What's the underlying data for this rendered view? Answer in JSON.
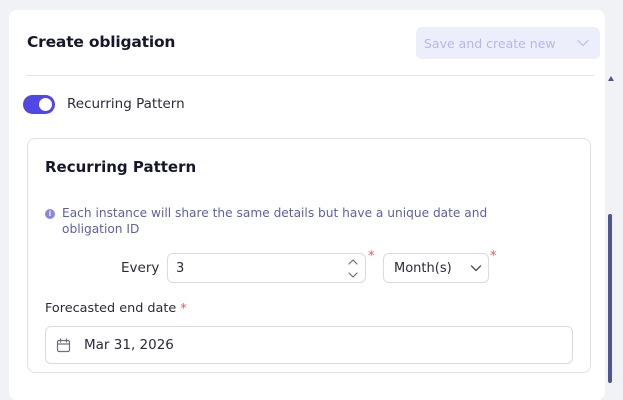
{
  "header": {
    "title": "Create obligation",
    "save_label": "Save and create new"
  },
  "toggle": {
    "label": "Recurring Pattern",
    "on": true
  },
  "recurring_card": {
    "title": "Recurring Pattern",
    "info_text": "Each instance will share the same details but have a unique date and obligation ID",
    "every_label": "Every",
    "interval_value": "3",
    "required_mark": "*",
    "period_selected": "Month(s)",
    "end_date_label": "Forecasted end date",
    "end_date_value": "Mar 31, 2026"
  },
  "colors": {
    "accent": "#5048e5",
    "required": "#e25c5c",
    "info": "#5b61a8",
    "disabled_button_bg": "#eceefb",
    "disabled_button_text": "#b6b9e6"
  },
  "icons": {
    "save_caret": "chevron-down-icon",
    "info": "info-icon",
    "stepper_up": "chevron-up-icon",
    "stepper_down": "chevron-down-icon",
    "select_caret": "chevron-down-icon",
    "calendar": "calendar-icon",
    "scroll_up": "scroll-up-arrow"
  }
}
